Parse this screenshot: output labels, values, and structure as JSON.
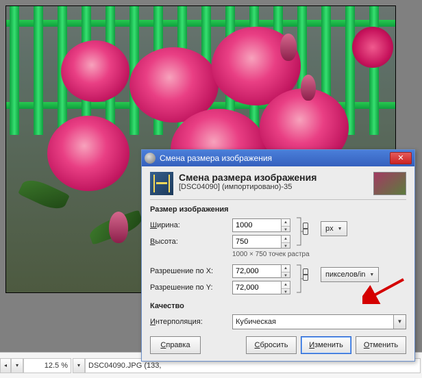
{
  "statusbar": {
    "zoom": "12.5 %",
    "filename": "DSC04090.JPG (133,"
  },
  "dialog": {
    "window_title": "Смена размера изображения",
    "close_glyph": "✕",
    "header": {
      "title": "Смена размера изображения",
      "subtitle": "[DSC04090] (импортировано)-35"
    },
    "section_size": "Размер изображения",
    "width_label_pre": "Ш",
    "width_label_rest": "ирина:",
    "height_label_pre": "В",
    "height_label_rest": "ысота:",
    "width_value": "1000",
    "height_value": "750",
    "unit_px": "px",
    "raster_hint": "1000 × 750 точек растра",
    "res_x_label": "Разрешение по X:",
    "res_y_label": "Разрешение по Y:",
    "res_x_value": "72,000",
    "res_y_value": "72,000",
    "unit_ppi": "пикселов/in",
    "section_quality": "Качество",
    "interp_label_pre": "И",
    "interp_label_rest": "нтерполяция:",
    "interp_value": "Кубическая",
    "buttons": {
      "help_pre": "С",
      "help_rest": "правка",
      "reset_pre": "С",
      "reset_rest": "бросить",
      "apply_pre": "И",
      "apply_rest": "зменить",
      "cancel_pre": "О",
      "cancel_rest": "тменить"
    }
  }
}
